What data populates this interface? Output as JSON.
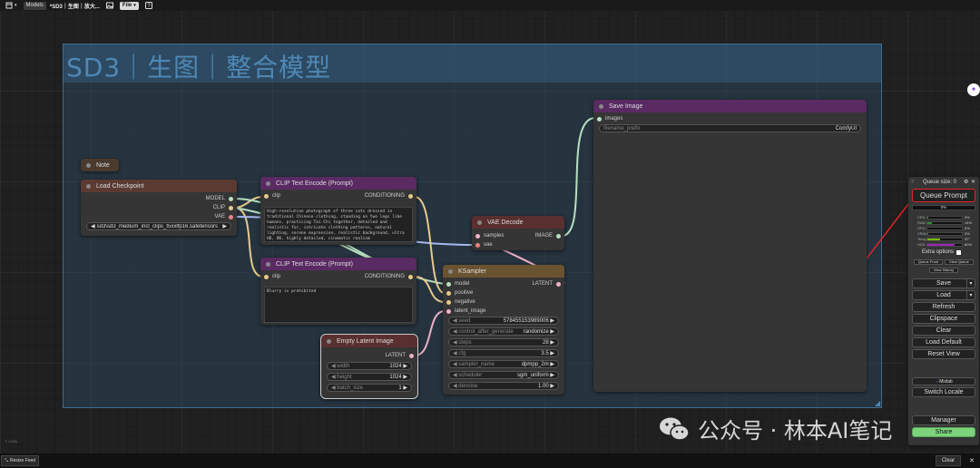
{
  "topbar": {
    "models_label": "Models",
    "workflow_title": "*SD3｜生图｜放大...",
    "file_label": "File"
  },
  "group": {
    "title": "SD3｜生图｜整合模型"
  },
  "note": {
    "title": "Note"
  },
  "load_checkpoint": {
    "title": "Load Checkpoint",
    "outputs": [
      "MODEL",
      "CLIP",
      "VAE"
    ],
    "ckpt_name": "sd3\\sd3_medium_incl_clips_t5xxlfp16.safetensors"
  },
  "clip_positive": {
    "title": "CLIP Text Encode (Prompt)",
    "input": "clip",
    "output": "CONDITIONING",
    "text": "High-resolution photograph of three cats dressed in traditional Chinese clothing, standing on two legs like humans, practicing Tai Chi together, detailed and realistic fur, intricate clothing patterns, natural lighting, serene expression, realistic background, ultra HD, 8K, highly detailed, cinematic realism"
  },
  "clip_negative": {
    "title": "CLIP Text Encode (Prompt)",
    "input": "clip",
    "output": "CONDITIONING",
    "text": "Blurry is prohibited"
  },
  "vae_decode": {
    "title": "VAE Decode",
    "inputs": [
      "samples",
      "vae"
    ],
    "output": "IMAGE"
  },
  "ksampler": {
    "title": "KSampler",
    "inputs": [
      "model",
      "positive",
      "negative",
      "latent_image"
    ],
    "output": "LATENT",
    "widgets": [
      {
        "label": "seed",
        "value": "578455153989006"
      },
      {
        "label": "control_after_generate",
        "value": "randomize"
      },
      {
        "label": "steps",
        "value": "28"
      },
      {
        "label": "cfg",
        "value": "3.5"
      },
      {
        "label": "sampler_name",
        "value": "dpmpp_2m"
      },
      {
        "label": "scheduler",
        "value": "sgm_uniform"
      },
      {
        "label": "denoise",
        "value": "1.00"
      }
    ]
  },
  "empty_latent": {
    "title": "Empty Latent Image",
    "output": "LATENT",
    "widgets": [
      {
        "label": "width",
        "value": "1024"
      },
      {
        "label": "height",
        "value": "1024"
      },
      {
        "label": "batch_size",
        "value": "1"
      }
    ]
  },
  "save_image": {
    "title": "Save Image",
    "input": "images",
    "filename_prefix_label": "filename_prefix",
    "filename_prefix_value": "ComfyUI"
  },
  "panel": {
    "queue_size": "Queue size: 0",
    "queue_prompt": "Queue Prompt",
    "progress_pct": "0%",
    "stats": [
      {
        "label": "CPU",
        "pct": "3%",
        "value": 0.03,
        "color": "#2e8b2e"
      },
      {
        "label": "RAM",
        "pct": "14%",
        "value": 0.14,
        "color": "#2e8b2e"
      },
      {
        "label": "GPU",
        "pct": "0%",
        "value": 0.0,
        "color": "#2e8b2e"
      },
      {
        "label": "VRAM",
        "pct": "3%",
        "value": 0.03,
        "color": "#2e8b2e"
      },
      {
        "label": "Temp",
        "pct": "37°",
        "value": 0.37,
        "color": "#7ab800"
      },
      {
        "label": "HDD",
        "pct": "80%",
        "value": 0.8,
        "color": "#9b26b6"
      }
    ],
    "extra_options": "Extra options",
    "queue_front": "Queue Front",
    "view_queue": "View Queue",
    "view_history": "View History",
    "save": "Save",
    "load": "Load",
    "refresh": "Refresh",
    "clipspace": "Clipspace",
    "clear": "Clear",
    "load_default": "Load Default",
    "reset_view": "Reset View",
    "mixlab": "Mixlab",
    "switch_locale": "Switch Locale",
    "manager": "Manager",
    "share": "Share"
  },
  "bottom": {
    "resize_feed": "Resize Feed",
    "clear": "Clear",
    "stats_text": "T: 0.00s"
  },
  "watermark": {
    "text": "公众号 · 林本AI笔记"
  },
  "colors": {
    "accent_red": "#e02424",
    "node_brown": "#5b3a32",
    "node_purple": "#5a2a63",
    "node_darkred": "#5a2f2f",
    "node_ochre": "#6a5330"
  }
}
